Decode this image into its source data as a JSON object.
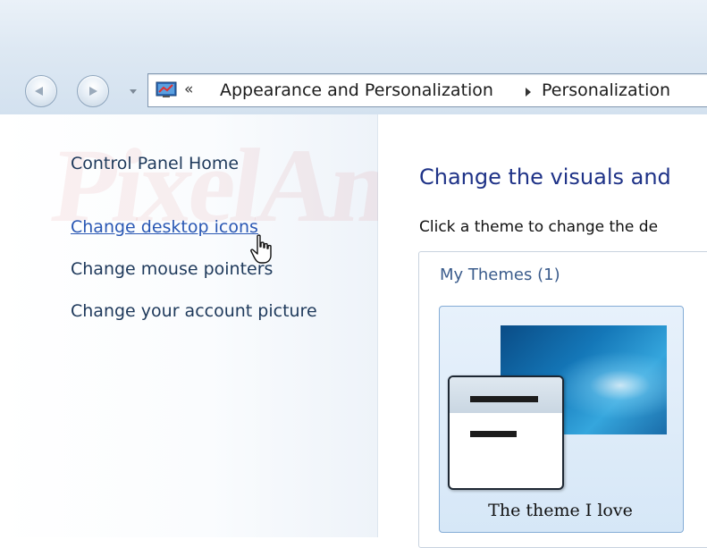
{
  "address_bar": {
    "overflow_chevron": "«",
    "crumbs": [
      "Appearance and Personalization",
      "Personalization"
    ]
  },
  "left_nav": {
    "home_link": "Control Panel Home",
    "links": [
      "Change desktop icons",
      "Change mouse pointers",
      "Change your account picture"
    ]
  },
  "main": {
    "heading": "Change the visuals and",
    "instruction": "Click a theme to change the de",
    "group_label": "My Themes (1)",
    "themes": [
      {
        "name": "The theme I love"
      }
    ]
  },
  "colors": {
    "link_hover": "#2a58b4",
    "heading": "#1e3287",
    "tile_border": "#84acd6"
  }
}
